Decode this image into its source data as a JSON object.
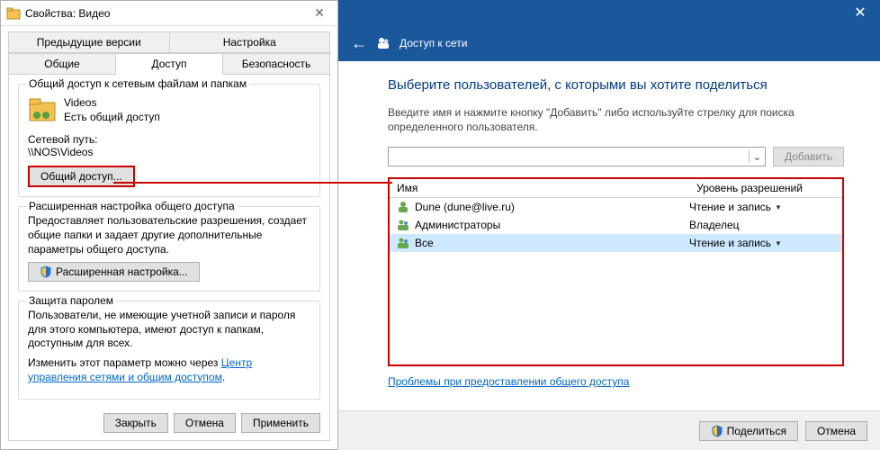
{
  "props": {
    "title": "Свойства: Видео",
    "tabs": {
      "prev_versions": "Предыдущие версии",
      "settings": "Настройка",
      "general": "Общие",
      "access": "Доступ",
      "security": "Безопасность"
    },
    "group1": {
      "title": "Общий доступ к сетевым файлам и папкам",
      "folder_name": "Videos",
      "folder_status": "Есть общий доступ",
      "net_path_label": "Сетевой путь:",
      "net_path": "\\\\NOS\\Videos",
      "share_btn": "Общий доступ..."
    },
    "group2": {
      "title": "Расширенная настройка общего доступа",
      "desc": "Предоставляет пользовательские разрешения, создает общие папки и задает другие дополнительные параметры общего доступа.",
      "adv_btn": "Расширенная настройка..."
    },
    "group3": {
      "title": "Защита паролем",
      "desc": "Пользователи, не имеющие учетной записи и пароля для этого компьютера, имеют доступ к папкам, доступным для всех.",
      "link_prefix": "Изменить этот параметр можно через ",
      "link_text": "Центр управления сетями и общим доступом",
      "link_suffix": "."
    },
    "buttons": {
      "close": "Закрыть",
      "cancel": "Отмена",
      "apply": "Применить"
    }
  },
  "net": {
    "header": "Доступ к сети",
    "heading": "Выберите пользователей, с которыми вы хотите поделиться",
    "instruction": "Введите имя и нажмите кнопку \"Добавить\" либо используйте стрелку для поиска определенного пользователя.",
    "add_btn": "Добавить",
    "col_name": "Имя",
    "col_level": "Уровень разрешений",
    "rows": [
      {
        "name": "Dune  (dune@live.ru)",
        "level": "Чтение и запись",
        "dd": true,
        "icon": "user"
      },
      {
        "name": "Администраторы",
        "level": "Владелец",
        "dd": false,
        "icon": "group"
      },
      {
        "name": "Все",
        "level": "Чтение и запись",
        "dd": true,
        "icon": "group",
        "selected": true
      }
    ],
    "trouble_link": "Проблемы при предоставлении общего доступа",
    "footer": {
      "share": "Поделиться",
      "cancel": "Отмена"
    }
  }
}
